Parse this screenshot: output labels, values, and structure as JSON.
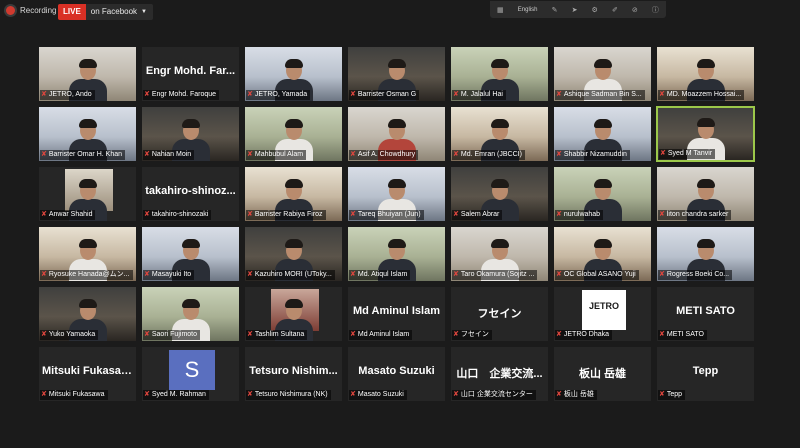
{
  "top_bar": {
    "recording_label": "Recording",
    "live_label": "LIVE",
    "stream_target": "on Facebook",
    "language": "English"
  },
  "icons": {
    "recording": "recording-dot-icon",
    "muted": "mic-muted-icon",
    "dropdown": "chevron-down-icon"
  },
  "colors": {
    "live_badge": "#d93025",
    "active_speaker_border": "#9cc84a",
    "muted_icon": "#e0463e",
    "avatar_bg": "#5a6fbf"
  },
  "participants": [
    {
      "name": "JETRO, Ando",
      "big": ""
    },
    {
      "name": "Engr Mohd. Faroque",
      "big": "Engr Mohd. Far..."
    },
    {
      "name": "JETRO, Yamada",
      "big": ""
    },
    {
      "name": "Barrister Osman G",
      "big": ""
    },
    {
      "name": "M. Jalalul Hai",
      "big": ""
    },
    {
      "name": "Ashique Sadman Bin S...",
      "big": ""
    },
    {
      "name": "MD. Moazzem Hossai...",
      "big": ""
    },
    {
      "name": "Barrister Omar H. Khan",
      "big": ""
    },
    {
      "name": "Nahian Moin",
      "big": ""
    },
    {
      "name": "Mahbubul Alam",
      "big": ""
    },
    {
      "name": "Asif A. Chowdhury",
      "big": ""
    },
    {
      "name": "Md. Emran (JBCCI)",
      "big": ""
    },
    {
      "name": "Shabbir Nizamuddin",
      "big": ""
    },
    {
      "name": "Syed M Tanvir",
      "big": ""
    },
    {
      "name": "Anwar Shahid",
      "big": ""
    },
    {
      "name": "takahiro-shinozaki",
      "big": "takahiro-shinoz..."
    },
    {
      "name": "Barrister Rabiya Firoz",
      "big": ""
    },
    {
      "name": "Tareq Bhuiyan (Jun)",
      "big": ""
    },
    {
      "name": "Salem Abrar",
      "big": ""
    },
    {
      "name": "nurulwahab",
      "big": ""
    },
    {
      "name": "liton chandra sarker",
      "big": ""
    },
    {
      "name": "Ryosuke Hanada@ムン...",
      "big": ""
    },
    {
      "name": "Masayuki Ito",
      "big": ""
    },
    {
      "name": "Kazuhiro MORI (UToky...",
      "big": ""
    },
    {
      "name": "Md. Atiqul Islam",
      "big": ""
    },
    {
      "name": "Taro Okamura (Sojitz ...",
      "big": ""
    },
    {
      "name": "OC Global ASANO Yuji",
      "big": ""
    },
    {
      "name": "Rogress Boeki Co...",
      "big": ""
    },
    {
      "name": "Yuko Yamaoka",
      "big": ""
    },
    {
      "name": "Saori Fujimoto",
      "big": ""
    },
    {
      "name": "Tashlim Sultana",
      "big": ""
    },
    {
      "name": "Md Aminul Islam",
      "big": "Md Aminul Islam"
    },
    {
      "name": "フセイン",
      "big": "フセイン"
    },
    {
      "name": "JETRO Dhaka",
      "big": ""
    },
    {
      "name": "METI SATO",
      "big": "METI SATO"
    },
    {
      "name": "Mitsuki Fukasawa",
      "big": "Mitsuki Fukasawa"
    },
    {
      "name": "Syed M. Rahman",
      "big": ""
    },
    {
      "name": "Tetsuro Nishimura (NK)",
      "big": "Tetsuro  Nishim..."
    },
    {
      "name": "Masato Suzuki",
      "big": "Masato Suzuki"
    },
    {
      "name": "山口 企業交流センター",
      "big": "山口　企業交流..."
    },
    {
      "name": "板山 岳雄",
      "big": "板山 岳雄"
    },
    {
      "name": "Tepp",
      "big": "Tepp"
    }
  ],
  "avatar_letter": "S",
  "logo_text": "JETRO"
}
